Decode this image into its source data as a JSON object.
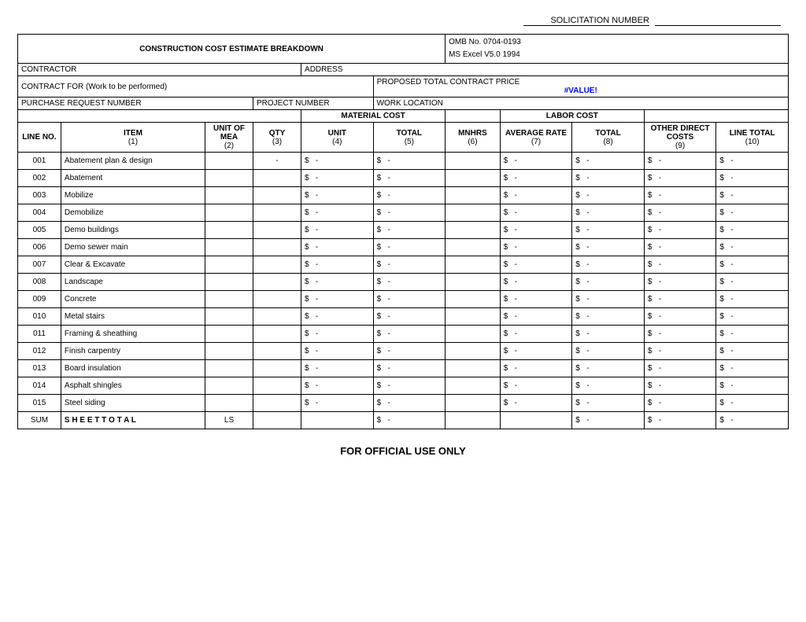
{
  "solicitation": {
    "label": "SOLICITATION NUMBER"
  },
  "header": {
    "title": "CONSTRUCTION COST ESTIMATE BREAKDOWN",
    "omb": "OMB No. 0704-0193",
    "excel": "MS Excel V5.0 1994"
  },
  "fields": {
    "contractor_label": "CONTRACTOR",
    "address_label": "ADDRESS",
    "contract_for_label": "CONTRACT FOR (Work to be performed)",
    "proposed_label": "PROPOSED TOTAL CONTRACT PRICE",
    "proposed_value": "#VALUE!",
    "purchase_request_label": "PURCHASE REQUEST NUMBER",
    "project_number_label": "PROJECT NUMBER",
    "work_location_label": "WORK LOCATION"
  },
  "columns": {
    "material_cost_label": "MATERIAL COST",
    "labor_cost_label": "LABOR COST",
    "line_no": "LINE NO.",
    "item": "ITEM",
    "unit_of_mea": "UNIT OF MEA",
    "qty": "QTY",
    "unit": "UNIT",
    "total_mat": "TOTAL",
    "mnhrs": "MNHRS",
    "average_rate": "AVERAGE RATE",
    "total_lab": "TOTAL",
    "other_direct": "OTHER DIRECT COSTS",
    "line_total": "LINE TOTAL",
    "sub1": "(1)",
    "sub2": "(2)",
    "sub3": "(3)",
    "sub4": "(4)",
    "sub5": "(5)",
    "sub6": "(6)",
    "sub7": "(7)",
    "sub8": "(8)",
    "sub9": "(9)",
    "sub10": "(10)"
  },
  "rows": [
    {
      "line": "001",
      "item": "Abatement plan & design"
    },
    {
      "line": "002",
      "item": "Abatement"
    },
    {
      "line": "003",
      "item": "Mobilize"
    },
    {
      "line": "004",
      "item": "Demobilize"
    },
    {
      "line": "005",
      "item": "Demo buildings"
    },
    {
      "line": "006",
      "item": "Demo sewer main"
    },
    {
      "line": "007",
      "item": "Clear & Excavate"
    },
    {
      "line": "008",
      "item": "Landscape"
    },
    {
      "line": "009",
      "item": "Concrete"
    },
    {
      "line": "010",
      "item": "Metal stairs"
    },
    {
      "line": "011",
      "item": "Framing & sheathing"
    },
    {
      "line": "012",
      "item": "Finish carpentry"
    },
    {
      "line": "013",
      "item": "Board insulation"
    },
    {
      "line": "014",
      "item": "Asphalt shingles"
    },
    {
      "line": "015",
      "item": "Steel siding"
    }
  ],
  "sum_row": {
    "line": "SUM",
    "item": "S H E E T   T O T A L",
    "unit": "LS"
  },
  "footer": "FOR OFFICIAL USE ONLY"
}
